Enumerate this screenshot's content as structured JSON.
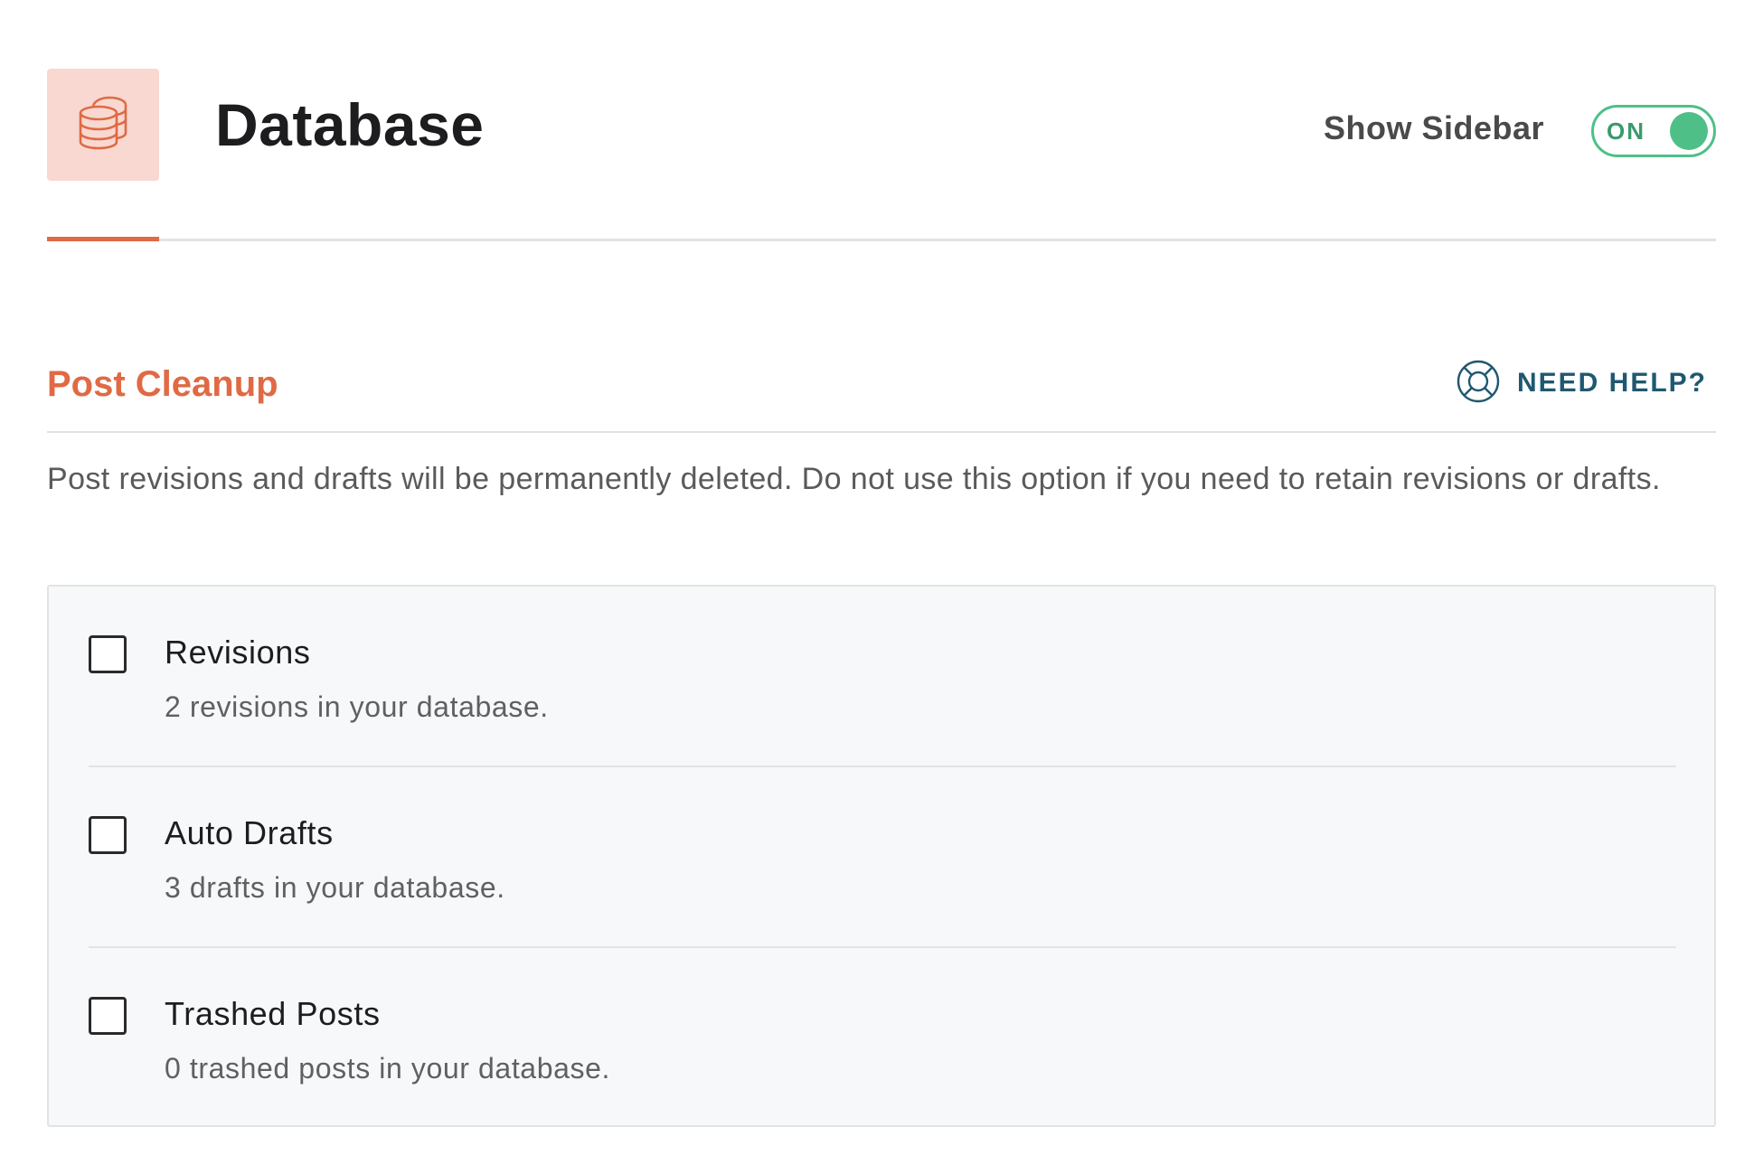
{
  "header": {
    "title": "Database",
    "icon": "database-icon",
    "sidebar_toggle": {
      "label": "Show Sidebar",
      "state_text": "ON",
      "checked": true
    }
  },
  "colors": {
    "accent": "#df6a44",
    "icon_background": "#f8d8d0",
    "toggle_green": "#4fbf88",
    "help_blue": "#1f5870"
  },
  "section": {
    "title": "Post Cleanup",
    "help": {
      "label": "NEED HELP?",
      "icon": "lifebuoy-icon"
    },
    "description": "Post revisions and drafts will be permanently deleted. Do not use this option if you need to retain revisions or drafts."
  },
  "options": [
    {
      "label": "Revisions",
      "meta": "2 revisions in your database.",
      "checked": false
    },
    {
      "label": "Auto Drafts",
      "meta": "3 drafts in your database.",
      "checked": false
    },
    {
      "label": "Trashed Posts",
      "meta": "0 trashed posts in your database.",
      "checked": false
    }
  ]
}
